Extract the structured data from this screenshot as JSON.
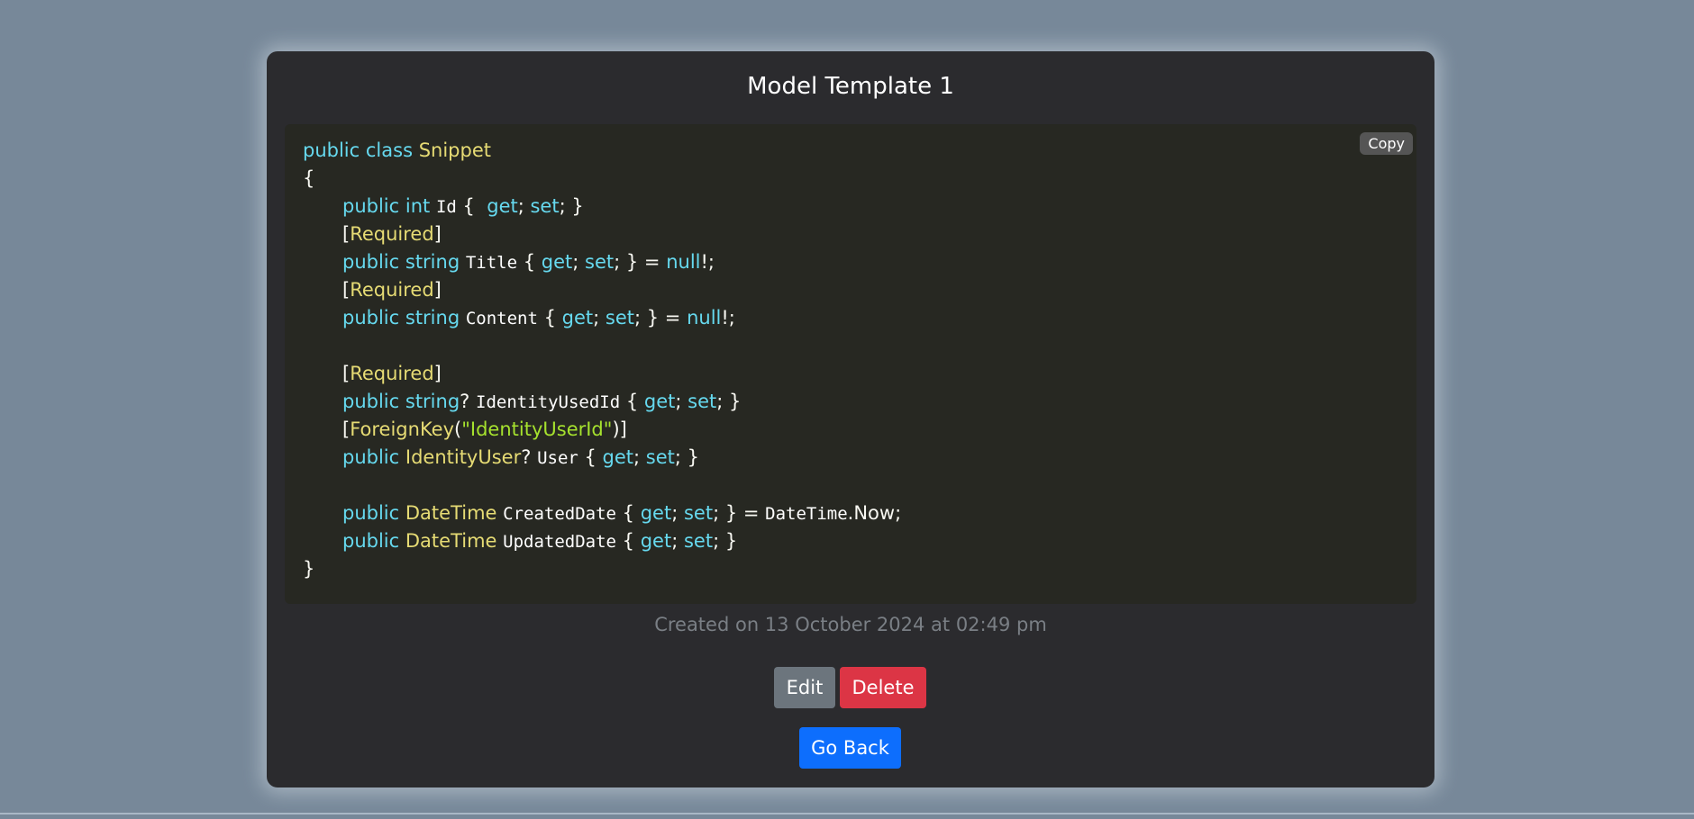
{
  "snippet": {
    "title": "Model Template 1",
    "copy_label": "Copy",
    "created_text": "Created on 13 October 2024 at 02:49 pm"
  },
  "code_lines": [
    {
      "indent": 0,
      "tokens": [
        {
          "t": "public",
          "c": "kw"
        },
        {
          "t": " ",
          "c": "pu"
        },
        {
          "t": "class",
          "c": "kw"
        },
        {
          "t": " ",
          "c": "pu"
        },
        {
          "t": "Snippet",
          "c": "ty"
        }
      ]
    },
    {
      "indent": 0,
      "tokens": [
        {
          "t": "{",
          "c": "pu"
        }
      ]
    },
    {
      "indent": 1,
      "tokens": [
        {
          "t": "public",
          "c": "kw"
        },
        {
          "t": " ",
          "c": "pu"
        },
        {
          "t": "int",
          "c": "kw"
        },
        {
          "t": " ",
          "c": "pu"
        },
        {
          "t": "Id",
          "c": "id"
        },
        {
          "t": " {  ",
          "c": "pu"
        },
        {
          "t": "get",
          "c": "kw"
        },
        {
          "t": "; ",
          "c": "pu"
        },
        {
          "t": "set",
          "c": "kw"
        },
        {
          "t": "; }",
          "c": "pu"
        }
      ]
    },
    {
      "indent": 1,
      "tokens": [
        {
          "t": "[",
          "c": "pu"
        },
        {
          "t": "Required",
          "c": "ty"
        },
        {
          "t": "]",
          "c": "pu"
        }
      ]
    },
    {
      "indent": 1,
      "tokens": [
        {
          "t": "public",
          "c": "kw"
        },
        {
          "t": " ",
          "c": "pu"
        },
        {
          "t": "string",
          "c": "kw"
        },
        {
          "t": " ",
          "c": "pu"
        },
        {
          "t": "Title",
          "c": "id"
        },
        {
          "t": " { ",
          "c": "pu"
        },
        {
          "t": "get",
          "c": "kw"
        },
        {
          "t": "; ",
          "c": "pu"
        },
        {
          "t": "set",
          "c": "kw"
        },
        {
          "t": "; } = ",
          "c": "pu"
        },
        {
          "t": "null",
          "c": "kw"
        },
        {
          "t": "!;",
          "c": "pu"
        }
      ]
    },
    {
      "indent": 1,
      "tokens": [
        {
          "t": "[",
          "c": "pu"
        },
        {
          "t": "Required",
          "c": "ty"
        },
        {
          "t": "]",
          "c": "pu"
        }
      ]
    },
    {
      "indent": 1,
      "tokens": [
        {
          "t": "public",
          "c": "kw"
        },
        {
          "t": " ",
          "c": "pu"
        },
        {
          "t": "string",
          "c": "kw"
        },
        {
          "t": " ",
          "c": "pu"
        },
        {
          "t": "Content",
          "c": "id"
        },
        {
          "t": " { ",
          "c": "pu"
        },
        {
          "t": "get",
          "c": "kw"
        },
        {
          "t": "; ",
          "c": "pu"
        },
        {
          "t": "set",
          "c": "kw"
        },
        {
          "t": "; } = ",
          "c": "pu"
        },
        {
          "t": "null",
          "c": "kw"
        },
        {
          "t": "!;",
          "c": "pu"
        }
      ]
    },
    {
      "indent": 0,
      "tokens": []
    },
    {
      "indent": 1,
      "tokens": [
        {
          "t": "[",
          "c": "pu"
        },
        {
          "t": "Required",
          "c": "ty"
        },
        {
          "t": "]",
          "c": "pu"
        }
      ]
    },
    {
      "indent": 1,
      "tokens": [
        {
          "t": "public",
          "c": "kw"
        },
        {
          "t": " ",
          "c": "pu"
        },
        {
          "t": "string",
          "c": "kw"
        },
        {
          "t": "? ",
          "c": "pu"
        },
        {
          "t": "IdentityUsedId",
          "c": "id"
        },
        {
          "t": " { ",
          "c": "pu"
        },
        {
          "t": "get",
          "c": "kw"
        },
        {
          "t": "; ",
          "c": "pu"
        },
        {
          "t": "set",
          "c": "kw"
        },
        {
          "t": "; }",
          "c": "pu"
        }
      ]
    },
    {
      "indent": 1,
      "tokens": [
        {
          "t": "[",
          "c": "pu"
        },
        {
          "t": "ForeignKey",
          "c": "ty"
        },
        {
          "t": "(",
          "c": "pu"
        },
        {
          "t": "\"IdentityUserId\"",
          "c": "st"
        },
        {
          "t": ")]",
          "c": "pu"
        }
      ]
    },
    {
      "indent": 1,
      "tokens": [
        {
          "t": "public",
          "c": "kw"
        },
        {
          "t": " ",
          "c": "pu"
        },
        {
          "t": "IdentityUser",
          "c": "ty"
        },
        {
          "t": "? ",
          "c": "pu"
        },
        {
          "t": "User",
          "c": "id"
        },
        {
          "t": " { ",
          "c": "pu"
        },
        {
          "t": "get",
          "c": "kw"
        },
        {
          "t": "; ",
          "c": "pu"
        },
        {
          "t": "set",
          "c": "kw"
        },
        {
          "t": "; }",
          "c": "pu"
        }
      ]
    },
    {
      "indent": 0,
      "tokens": []
    },
    {
      "indent": 1,
      "tokens": [
        {
          "t": "public",
          "c": "kw"
        },
        {
          "t": " ",
          "c": "pu"
        },
        {
          "t": "DateTime",
          "c": "ty"
        },
        {
          "t": " ",
          "c": "pu"
        },
        {
          "t": "CreatedDate",
          "c": "id"
        },
        {
          "t": " { ",
          "c": "pu"
        },
        {
          "t": "get",
          "c": "kw"
        },
        {
          "t": "; ",
          "c": "pu"
        },
        {
          "t": "set",
          "c": "kw"
        },
        {
          "t": "; } = ",
          "c": "pu"
        },
        {
          "t": "DateTime",
          "c": "id"
        },
        {
          "t": ".Now;",
          "c": "pu"
        }
      ]
    },
    {
      "indent": 1,
      "tokens": [
        {
          "t": "public",
          "c": "kw"
        },
        {
          "t": " ",
          "c": "pu"
        },
        {
          "t": "DateTime",
          "c": "ty"
        },
        {
          "t": " ",
          "c": "pu"
        },
        {
          "t": "UpdatedDate",
          "c": "id"
        },
        {
          "t": " { ",
          "c": "pu"
        },
        {
          "t": "get",
          "c": "kw"
        },
        {
          "t": "; ",
          "c": "pu"
        },
        {
          "t": "set",
          "c": "kw"
        },
        {
          "t": "; }",
          "c": "pu"
        }
      ]
    },
    {
      "indent": 0,
      "tokens": [
        {
          "t": "}",
          "c": "pu"
        }
      ]
    }
  ],
  "actions": {
    "edit_label": "Edit",
    "delete_label": "Delete",
    "back_label": "Go Back"
  },
  "colors": {
    "page_background": "#778899",
    "card_background": "#2b2b2e",
    "code_background": "#272822",
    "keyword": "#66d9ef",
    "type": "#e6db74",
    "string": "#a6e22e",
    "edit": "#6c757d",
    "delete": "#dc3545",
    "back": "#0d6efd"
  }
}
